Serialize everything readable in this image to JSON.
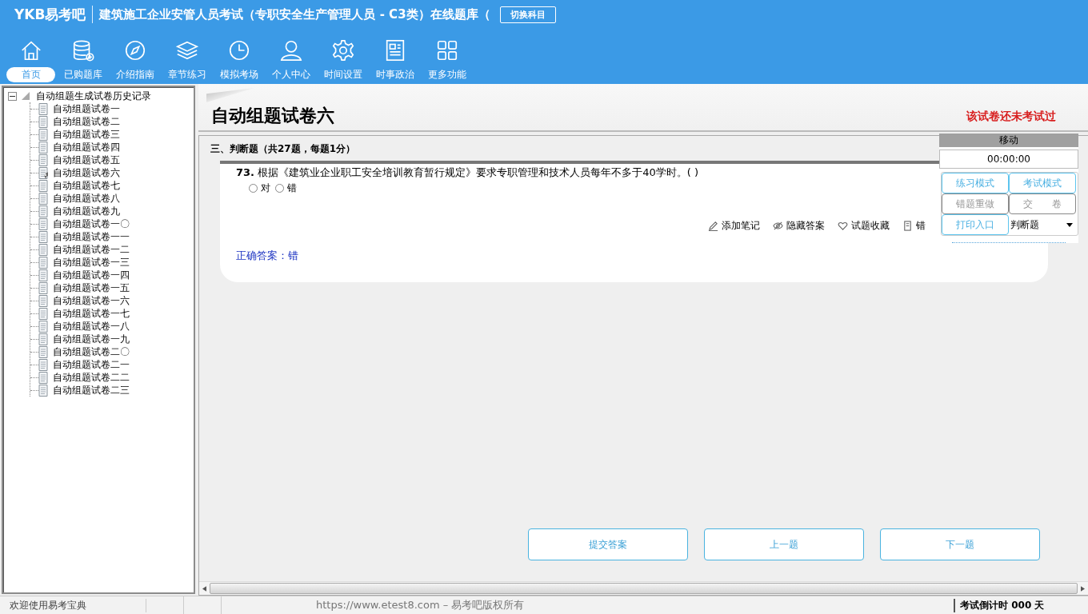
{
  "header": {
    "logo": "YKB易考吧",
    "title": "建筑施工企业安管人员考试（专职安全生产管理人员 - C3类）在线题库（",
    "switch_button": "切换科目"
  },
  "nav": [
    {
      "label": "首页",
      "kind": "home",
      "selected": true
    },
    {
      "label": "已购题库",
      "kind": "database",
      "selected": false
    },
    {
      "label": "介绍指南",
      "kind": "compass",
      "selected": false
    },
    {
      "label": "章节练习",
      "kind": "layers",
      "selected": false
    },
    {
      "label": "模拟考场",
      "kind": "clock",
      "selected": false
    },
    {
      "label": "个人中心",
      "kind": "user",
      "selected": false
    },
    {
      "label": "时间设置",
      "kind": "gear",
      "selected": false
    },
    {
      "label": "时事政治",
      "kind": "news",
      "selected": false
    },
    {
      "label": "更多功能",
      "kind": "grid",
      "selected": false
    }
  ],
  "tree": {
    "label": "自动组题生成试卷历史记录",
    "expanded": true,
    "children": [
      {
        "label": "自动组题试卷一",
        "current": false
      },
      {
        "label": "自动组题试卷二",
        "current": false
      },
      {
        "label": "自动组题试卷三",
        "current": false
      },
      {
        "label": "自动组题试卷四",
        "current": false
      },
      {
        "label": "自动组题试卷五",
        "current": false
      },
      {
        "label": "自动组题试卷六",
        "current": true
      },
      {
        "label": "自动组题试卷七",
        "current": false
      },
      {
        "label": "自动组题试卷八",
        "current": false
      },
      {
        "label": "自动组题试卷九",
        "current": false
      },
      {
        "label": "自动组题试卷一〇",
        "current": false
      },
      {
        "label": "自动组题试卷一一",
        "current": false
      },
      {
        "label": "自动组题试卷一二",
        "current": false
      },
      {
        "label": "自动组题试卷一三",
        "current": false
      },
      {
        "label": "自动组题试卷一四",
        "current": false
      },
      {
        "label": "自动组题试卷一五",
        "current": false
      },
      {
        "label": "自动组题试卷一六",
        "current": false
      },
      {
        "label": "自动组题试卷一七",
        "current": false
      },
      {
        "label": "自动组题试卷一八",
        "current": false
      },
      {
        "label": "自动组题试卷一九",
        "current": false
      },
      {
        "label": "自动组题试卷二〇",
        "current": false
      },
      {
        "label": "自动组题试卷二一",
        "current": false
      },
      {
        "label": "自动组题试卷二二",
        "current": false
      },
      {
        "label": "自动组题试卷二三",
        "current": false
      }
    ]
  },
  "paper": {
    "title": "自动组题试卷六",
    "status": "该试卷还未考试过"
  },
  "section": "三、判断题（共27题，每题1分）",
  "question": {
    "number": "73.",
    "text": "根据《建筑业企业职工安全培训教育暂行规定》要求专职管理和技术人员每年不多于40学时。( )",
    "options": [
      {
        "label": "对",
        "checked": false
      },
      {
        "label": "错",
        "checked": false
      }
    ],
    "tools": [
      {
        "label": "添加笔记",
        "kind": "pencil"
      },
      {
        "label": "隐藏答案",
        "kind": "eye"
      },
      {
        "label": "试题收藏",
        "kind": "heart"
      },
      {
        "label": "错",
        "kind": "book"
      }
    ],
    "answer": "正确答案：错"
  },
  "panel": {
    "title": "移动",
    "timer": "00:00:00",
    "buttons": [
      {
        "label": "练习模式",
        "enabled": true
      },
      {
        "label": "考试模式",
        "enabled": true
      },
      {
        "label": "错题重做",
        "enabled": false
      },
      {
        "label": "交　　卷",
        "enabled": false
      },
      {
        "label": "打印入口",
        "enabled": true
      }
    ],
    "select": "判断题"
  },
  "nav_buttons": [
    "提交答案",
    "上一题",
    "下一题"
  ],
  "status_bar": {
    "welcome": "欢迎使用易考宝典",
    "copyright": "https://www.etest8.com – 易考吧版权所有",
    "countdown": "考试倒计时 000 天"
  }
}
